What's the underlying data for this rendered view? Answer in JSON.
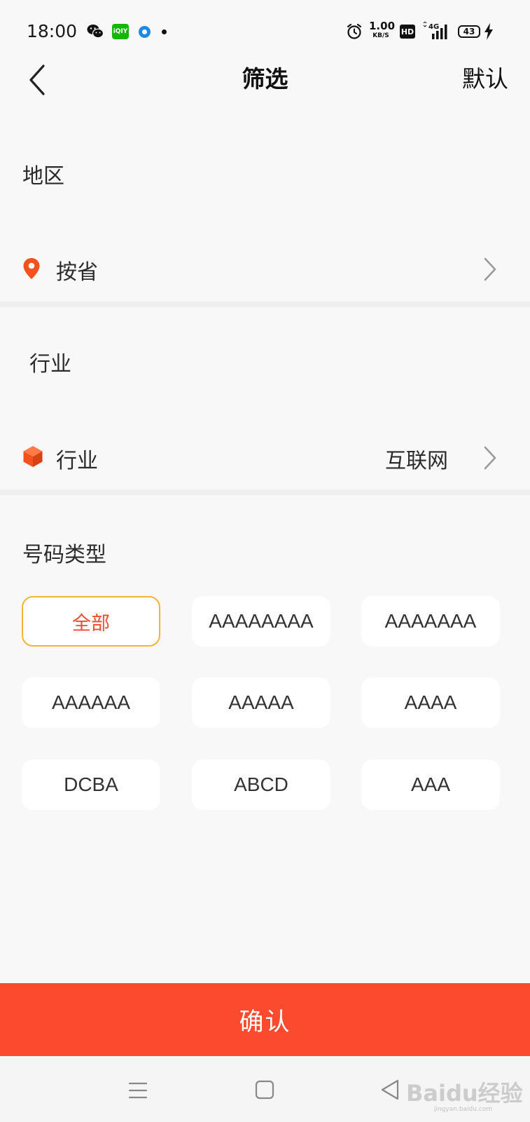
{
  "status_bar": {
    "time": "18:00",
    "iqiyi_badge": "iQIY",
    "net_speed_value": "1.00",
    "net_speed_unit": "KB/S",
    "hd_badge": "HD",
    "network_badge": "4G",
    "battery_level": "43",
    "icons": [
      "wechat-icon",
      "iqiyi-icon",
      "circle-icon",
      "dot-icon",
      "alarm-icon",
      "signal-icon",
      "battery-icon",
      "charging-bolt-icon"
    ]
  },
  "nav": {
    "title": "筛选",
    "default_label": "默认"
  },
  "region": {
    "section_title": "地区",
    "row_label": "按省"
  },
  "industry": {
    "section_title": "行业",
    "row_label": "行业",
    "row_value": "互联网"
  },
  "number_type": {
    "section_title": "号码类型",
    "selected_index": 0,
    "options": [
      "全部",
      "AAAAAAAA",
      "AAAAAAA",
      "AAAAAA",
      "AAAAA",
      "AAAA",
      "DCBA",
      "ABCD",
      "AAA"
    ]
  },
  "confirm_label": "确认",
  "watermark": {
    "text": "Baidu经验",
    "sub": "jingyan.baidu.com"
  },
  "colors": {
    "accent": "#fb4a2e",
    "selected_border": "#f1b533",
    "selected_text": "#f04b2d",
    "location_pin": "#f4511e",
    "cube": "#f4511e",
    "background": "#f8f8f8"
  }
}
